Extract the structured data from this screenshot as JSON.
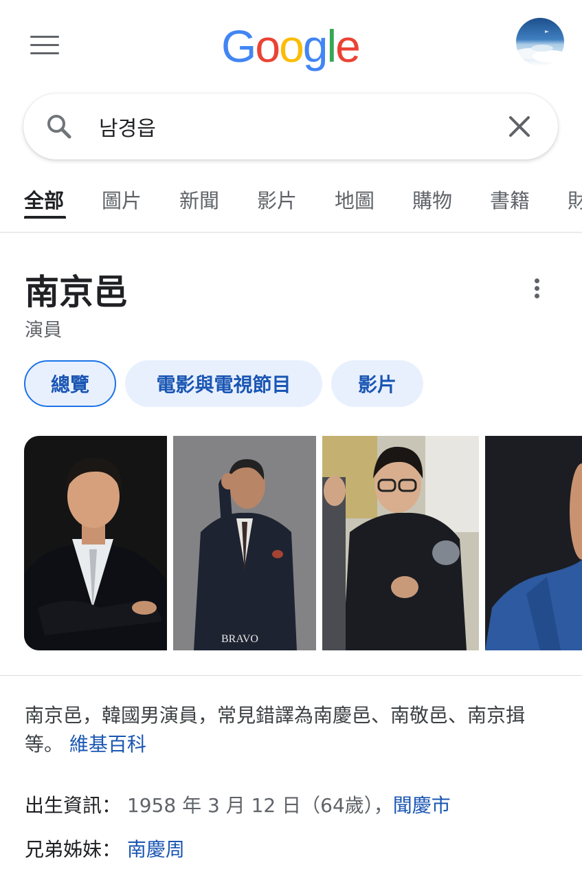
{
  "header": {
    "menu_icon": "hamburger-menu-icon",
    "logo_text": "Google",
    "avatar_icon": "profile-avatar"
  },
  "search": {
    "value": "남경읍",
    "search_icon": "search-icon",
    "clear_icon": "close-icon"
  },
  "tabs": [
    {
      "label": "全部",
      "active": true
    },
    {
      "label": "圖片"
    },
    {
      "label": "新聞"
    },
    {
      "label": "影片"
    },
    {
      "label": "地圖"
    },
    {
      "label": "購物"
    },
    {
      "label": "書籍"
    },
    {
      "label": "財"
    }
  ],
  "knowledge_panel": {
    "title": "南京邑",
    "subtitle": "演員",
    "chips": [
      {
        "label": "總覽",
        "active": true
      },
      {
        "label": "電影與電視節目"
      },
      {
        "label": "影片"
      }
    ],
    "photos": [
      "man-in-suit-arms-crossed",
      "man-in-suit-hand-on-head",
      "man-with-glasses-escorted",
      "man-in-blue-suit-partial"
    ],
    "photo_caption": "BRAVO",
    "description": "南京邑，韓國男演員，常見錯譯為南慶邑、南敬邑、南京揖等。",
    "source_link": "維基百科",
    "facts": {
      "birth_label": "出生資訊：",
      "birth_value": "1958 年 3 月 12 日（64歲）",
      "birth_sep": "，",
      "birth_place": "聞慶市",
      "sibling_label": "兄弟姊妹：",
      "sibling_value": "南慶周"
    }
  },
  "colors": {
    "link": "#1a56b3",
    "chip_bg": "#e8f0fe",
    "chip_border": "#1a73e8",
    "text": "#202124",
    "muted": "#5f6368"
  }
}
